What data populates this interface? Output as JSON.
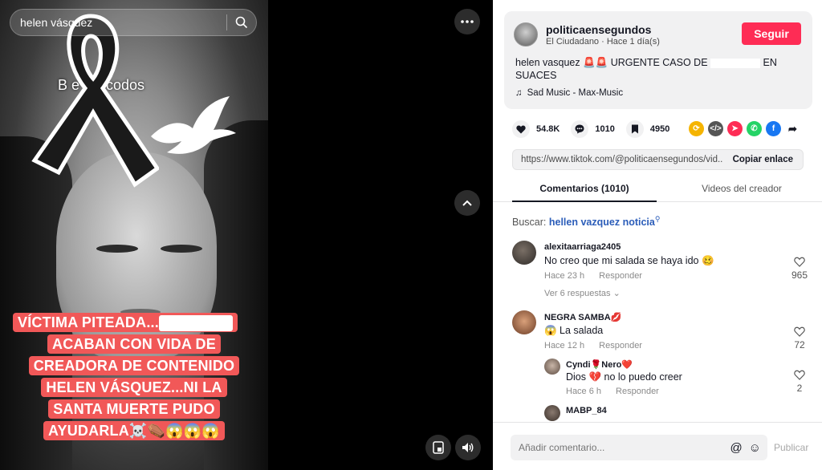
{
  "search": {
    "value": "helen vásquez",
    "icon": "search-icon"
  },
  "video": {
    "overlay_top": "B           e los codos",
    "caption_lines": [
      "VÍCTIMA PITEADA...",
      "ACABAN CON VIDA DE",
      "CREADORA DE CONTENIDO",
      "HELEN VÁSQUEZ...NI LA",
      "SANTA MUERTE PUDO",
      "AYUDARLA☠️⚰️😱😱😱"
    ]
  },
  "post": {
    "username": "politicaensegundos",
    "meta": "El Ciudadano · Hace 1 día(s)",
    "follow_label": "Seguir",
    "desc_part1": "helen vasquez 🚨🚨 URGENTE CASO DE",
    "desc_part2": "EN SUACES",
    "music": "Sad Music - Max-Music"
  },
  "stats": {
    "likes": "54.8K",
    "comments": "1010",
    "saves": "4950"
  },
  "link": {
    "url": "https://www.tiktok.com/@politicaensegundos/vid...",
    "copy_label": "Copiar enlace"
  },
  "tabs": {
    "comments": "Comentarios (1010)",
    "creator_videos": "Videos del creador"
  },
  "search_suggestion": {
    "label": "Buscar:",
    "query": "hellen vazquez noticia"
  },
  "comments": [
    {
      "user": "alexitaarriaga2405",
      "text": "No creo que mi salada se haya ido 🥴",
      "time": "Hace 23 h",
      "reply": "Responder",
      "likes": "965",
      "more": "Ver 6 respuestas"
    },
    {
      "user": "NEGRA SAMBA💋",
      "text": "😱 La salada",
      "time": "Hace 12 h",
      "reply": "Responder",
      "likes": "72"
    }
  ],
  "replies": [
    {
      "user": "Cyndi🌹Nero❤️",
      "text": "Dios 💔 no lo puedo creer",
      "time": "Hace 6 h",
      "reply": "Responder",
      "likes": "2"
    },
    {
      "user": "MABP_84",
      "text": "",
      "time": "",
      "reply": "",
      "likes": ""
    }
  ],
  "footer": {
    "placeholder": "Añadir comentario...",
    "publish": "Publicar"
  },
  "colors": {
    "accent": "#fe2c55",
    "caption_bg": "#f15858",
    "link": "#2b5db9"
  }
}
